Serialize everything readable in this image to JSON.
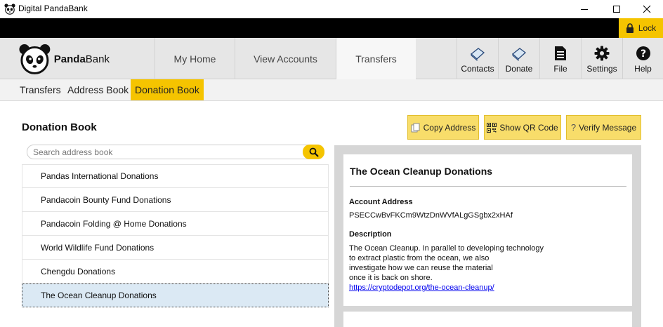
{
  "window": {
    "title": "Digital PandaBank"
  },
  "topbar": {
    "lock_label": "Lock"
  },
  "logo": {
    "bold": "Panda",
    "regular": "Bank"
  },
  "nav": {
    "tabs": [
      {
        "label": "My Home"
      },
      {
        "label": "View Accounts"
      },
      {
        "label": "Transfers",
        "active": true
      }
    ],
    "tools": [
      {
        "label": "Contacts",
        "icon": "contacts-icon"
      },
      {
        "label": "Donate",
        "icon": "donate-icon"
      },
      {
        "label": "File",
        "icon": "file-icon"
      },
      {
        "label": "Settings",
        "icon": "gear-icon"
      },
      {
        "label": "Help",
        "icon": "help-icon"
      }
    ]
  },
  "subnav": {
    "tabs": [
      {
        "label": "Transfers"
      },
      {
        "label": "Address Book"
      },
      {
        "label": "Donation Book",
        "active": true
      }
    ]
  },
  "page": {
    "title": "Donation Book"
  },
  "actions": {
    "copy_address": "Copy Address",
    "show_qr": "Show QR Code",
    "verify_message": "Verify Message"
  },
  "search": {
    "placeholder": "Search address book"
  },
  "donations": [
    "Pandas International Donations",
    "Pandacoin Bounty Fund Donations",
    "Pandacoin Folding @ Home Donations",
    "World Wildlife Fund Donations",
    "Chengdu Donations",
    "The Ocean Cleanup Donations"
  ],
  "selected_index": 5,
  "detail": {
    "title": "The Ocean Cleanup Donations",
    "account_address_label": "Account Address",
    "account_address": "PSECCwBvFKCm9WtzDnWVfALgGSgbx2xHAf",
    "description_label": "Description",
    "description_lines": [
      "The Ocean Cleanup. In parallel to developing technology",
      "to extract plastic from the ocean, we also",
      "investigate how we can reuse the material",
      "once it is back on shore."
    ],
    "link": "https://cryptodepot.org/the-ocean-cleanup/"
  },
  "colors": {
    "accent": "#f5c400",
    "selected_row": "#dbe9f4",
    "nav_bg": "#e6e6e6"
  }
}
